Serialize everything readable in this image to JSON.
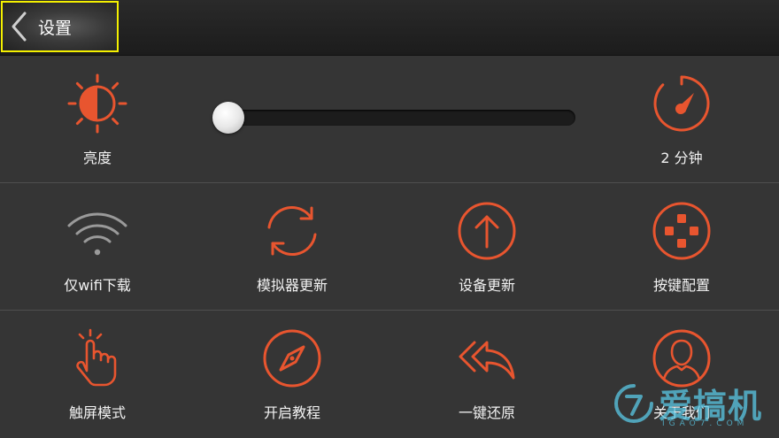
{
  "header": {
    "title": "设置"
  },
  "brightness": {
    "label": "亮度",
    "level": 0.02
  },
  "timeout": {
    "label": "2 分钟"
  },
  "items": [
    {
      "label": "仅wifi下载",
      "icon": "wifi-icon"
    },
    {
      "label": "模拟器更新",
      "icon": "refresh-icon"
    },
    {
      "label": "设备更新",
      "icon": "arrow-up-circle-icon"
    },
    {
      "label": "按键配置",
      "icon": "dpad-icon"
    },
    {
      "label": "触屏模式",
      "icon": "touch-hand-icon"
    },
    {
      "label": "开启教程",
      "icon": "compass-icon"
    },
    {
      "label": "一键还原",
      "icon": "reply-all-icon"
    },
    {
      "label": "关于我们",
      "icon": "user-icon"
    }
  ],
  "watermark": {
    "brand": "爱搞机",
    "site": "IGAO7.COM"
  },
  "colors": {
    "accent": "#e8552f",
    "background": "#353535",
    "highlight": "#f4f000"
  }
}
